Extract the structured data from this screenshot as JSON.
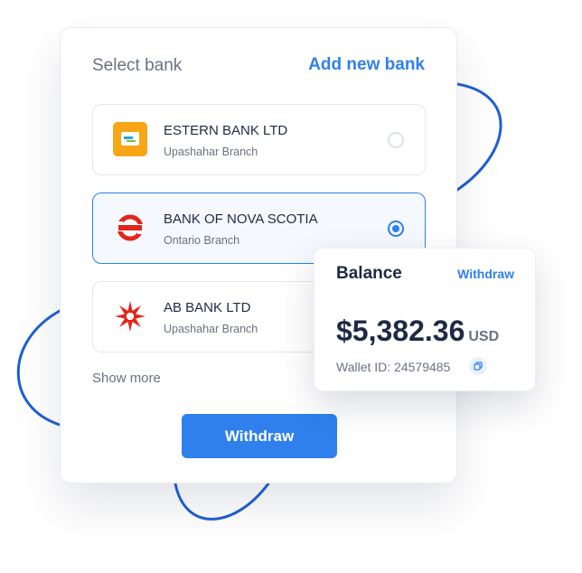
{
  "select_bank": {
    "title": "Select bank",
    "add_new_label": "Add new bank",
    "show_more_label": "Show more",
    "withdraw_label": "Withdraw",
    "banks": [
      {
        "name": "ESTERN BANK LTD",
        "branch": "Upashahar Branch",
        "selected": false,
        "logo": "eastern-bank-logo"
      },
      {
        "name": "BANK OF NOVA SCOTIA",
        "branch": "Ontario Branch",
        "selected": true,
        "logo": "scotiabank-logo"
      },
      {
        "name": "AB BANK LTD",
        "branch": "Upashahar Branch",
        "selected": false,
        "logo": "ab-bank-logo"
      }
    ]
  },
  "balance": {
    "title": "Balance",
    "withdraw_link": "Withdraw",
    "amount": "$5,382.36",
    "currency": "USD",
    "wallet_id": "Wallet ID: 24579485",
    "copy_icon": "copy-icon"
  },
  "colors": {
    "accent": "#2f80ed",
    "text_dark": "#1e2a44",
    "text_muted": "#6b7280",
    "decor_line": "#1f5fd6"
  }
}
